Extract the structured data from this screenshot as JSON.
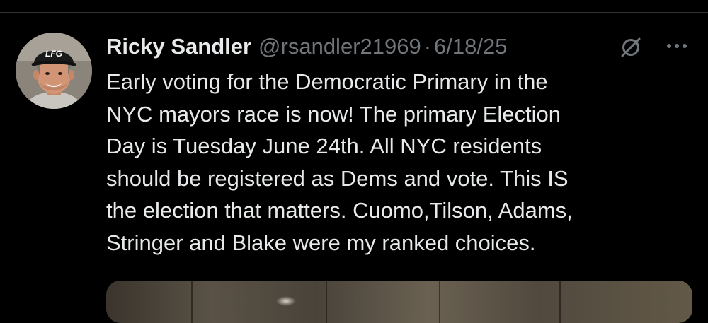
{
  "tweet": {
    "display_name": "Ricky Sandler",
    "handle": "@rsandler21969",
    "separator": "·",
    "date": "6/18/25",
    "lines": [
      "Early voting for the Democratic Primary in the",
      "NYC mayors race is now!  The primary Election",
      "Day is Tuesday June 24th.  All NYC residents",
      "should be registered as Dems and vote.  This IS",
      "the election that matters.  Cuomo,Tilson, Adams,",
      "Stringer and Blake were my ranked choices."
    ]
  },
  "avatar": {
    "hat_text": "LFG"
  },
  "icons": {
    "grok": "grok-slash-icon",
    "more": "more-icon"
  },
  "colors": {
    "background": "#000000",
    "text": "#e7e9ea",
    "secondary_text": "#71767b",
    "divider": "#2f3336"
  }
}
